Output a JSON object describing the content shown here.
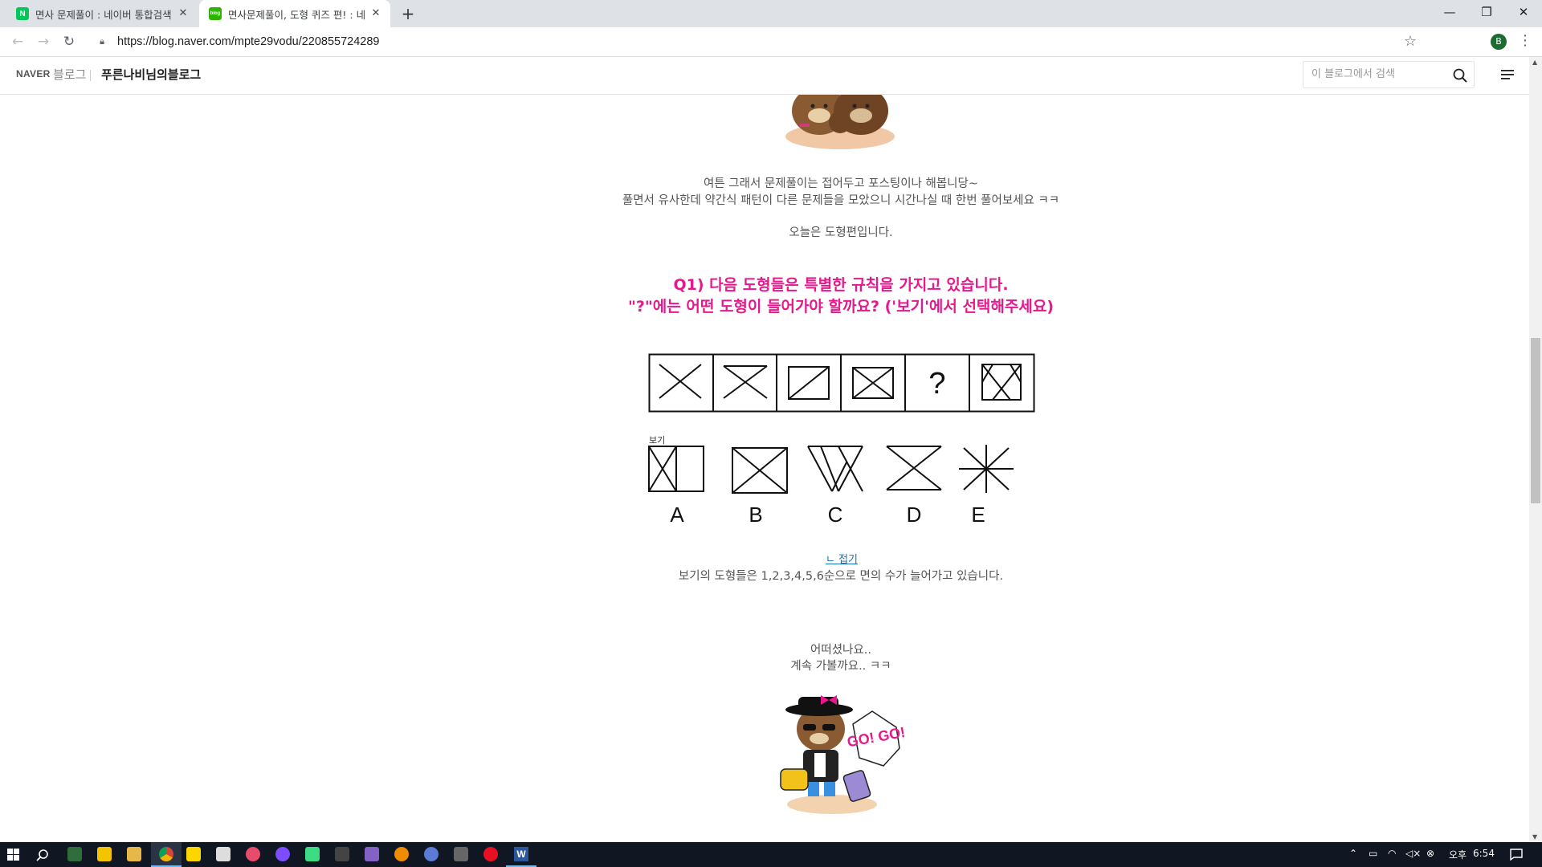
{
  "browser": {
    "tabs": [
      {
        "title": "면사 문제풀이 : 네이버 통합검색",
        "favicon": "N",
        "favicon_color": "#03c75a",
        "active": false
      },
      {
        "title": "면사문제풀이, 도형 퀴즈 편! : 네",
        "favicon": "blog",
        "favicon_color": "#2db400",
        "active": true
      }
    ],
    "url": "https://blog.naver.com/mpte29vodu/220855724289",
    "profile_initial": "B"
  },
  "blog_header": {
    "logo": "NAVER",
    "blog_label": "블로그",
    "blog_name": "푸른나비님의블로그",
    "search_placeholder": "이 블로그에서 검색"
  },
  "post": {
    "intro_line1": "여튼 그래서 문제풀이는 접어두고 포스팅이나 해봅니당~",
    "intro_line2": "풀면서 유사한데 약간식 패턴이 다른 문제들을 모았으니 시간나실 때 한번 풀어보세요 ㅋㅋ",
    "intro_line3": "오늘은 도형편입니다.",
    "question_line1": "Q1) 다음 도형들은 특별한 규칙을 가지고 있습니다.",
    "question_line2": "\"?\"에는 어떤 도형이 들어가야 할까요? ('보기'에서 선택해주세요)",
    "question_mark": "?",
    "options_label": "보기",
    "options": [
      "A",
      "B",
      "C",
      "D",
      "E"
    ],
    "fold_label": "ㄴ 접기",
    "answer_text": "보기의 도형들은 1,2,3,4,5,6순으로 면의 수가 늘어가고 있습니다.",
    "outro_line1": "어떠셨나요..",
    "outro_line2": "계속 가볼까요.. ㅋㅋ",
    "sticker_text": "GO! GO!"
  },
  "taskbar": {
    "time_period": "오후",
    "time": "6:54"
  }
}
